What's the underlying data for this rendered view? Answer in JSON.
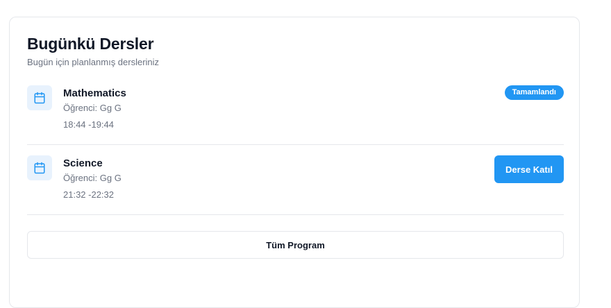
{
  "header": {
    "title": "Bugünkü Dersler",
    "subtitle": "Bugün için planlanmış dersleriniz"
  },
  "lessons": [
    {
      "title": "Mathematics",
      "student": "Öğrenci: Gg G",
      "time": "18:44 -19:44",
      "status_label": "Tamamlandı",
      "icon": "calendar-icon"
    },
    {
      "title": "Science",
      "student": "Öğrenci: Gg G",
      "time": "21:32 -22:32",
      "action_label": "Derse Katıl",
      "icon": "calendar-icon"
    }
  ],
  "footer": {
    "full_program_label": "Tüm Program"
  },
  "colors": {
    "accent": "#2196f3",
    "icon_bg": "#e8f2fd",
    "border": "#e5e7eb",
    "muted_text": "#6b7280"
  }
}
